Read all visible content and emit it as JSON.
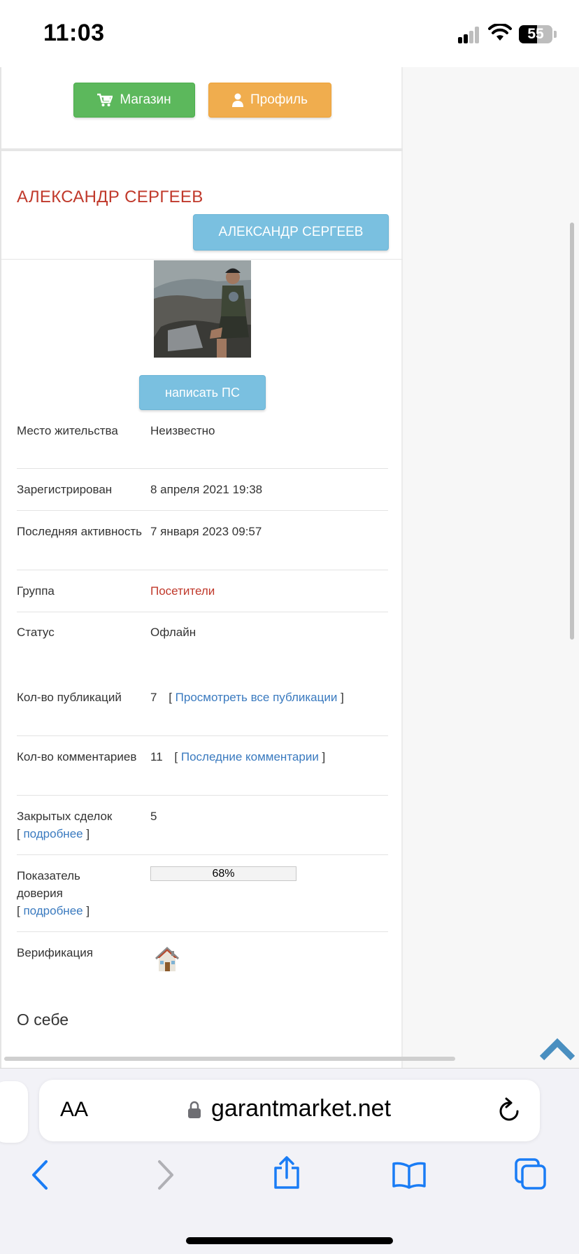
{
  "status_bar": {
    "time": "11:03",
    "battery": "55"
  },
  "top_buttons": {
    "shop_label": "Магазин",
    "profile_label": "Профиль"
  },
  "profile": {
    "title": "АЛЕКСАНДР СЕРГЕЕВ",
    "name_button": "АЛЕКСАНДР СЕРГЕЕВ",
    "pm_button": "написать ПС"
  },
  "info": {
    "residence_label": "Место жительства",
    "residence_value": "Неизвестно",
    "registered_label": "Зарегистрирован",
    "registered_value": "8 апреля 2021 19:38",
    "last_active_label": "Последняя активность",
    "last_active_value": "7 января 2023 09:57",
    "group_label": "Группа",
    "group_value": "Посетители",
    "status_label": "Статус",
    "status_value": "Офлайн",
    "posts_label": "Кол-во публикаций",
    "posts_count": "7",
    "posts_link": "Просмотреть все публикации",
    "comments_label": "Кол-во комментариев",
    "comments_count": "11",
    "comments_link": "Последние комментарии",
    "deals_label": "Закрытых сделок",
    "deals_more_link": "подробнее",
    "deals_value": "5",
    "trust_label": "Показатель доверия",
    "trust_more_link": "подробнее",
    "trust_percent": 68,
    "trust_text": "68%",
    "verification_label": "Верификация",
    "verification_icon": "house-icon"
  },
  "about_heading": "О себе",
  "browser": {
    "aa_label": "AA",
    "url": "garantmarket.net"
  },
  "colors": {
    "shop_button": "#5cb85c",
    "profile_button": "#f0ad4e",
    "info_button": "#7ac0e0",
    "title_red": "#c0392b",
    "link_blue": "#3a7abf"
  }
}
